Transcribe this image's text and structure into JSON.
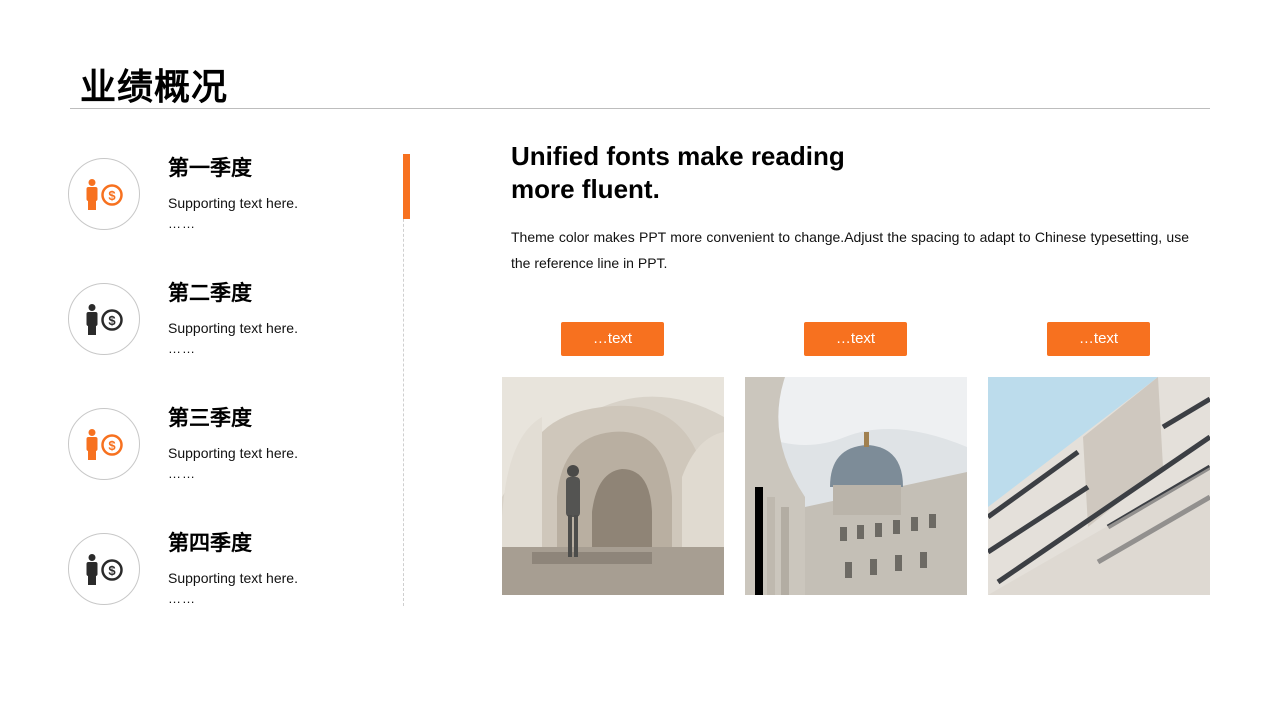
{
  "page": {
    "title": "业绩概况"
  },
  "quarters": [
    {
      "title": "第一季度",
      "text": "Supporting text here.",
      "more": "……",
      "icon_color": "#f7711f"
    },
    {
      "title": "第二季度",
      "text": "Supporting text here.",
      "more": "……",
      "icon_color": "#2b2b2b"
    },
    {
      "title": "第三季度",
      "text": "Supporting text here.",
      "more": "……",
      "icon_color": "#f7711f"
    },
    {
      "title": "第四季度",
      "text": "Supporting text here.",
      "more": "……",
      "icon_color": "#2b2b2b"
    }
  ],
  "content": {
    "heading": "Unified fonts make reading more fluent.",
    "body": "Theme color makes PPT more convenient to change.Adjust the spacing to adapt to Chinese typesetting, use the reference line in PPT."
  },
  "tags": [
    "…text",
    "…text",
    "…text"
  ],
  "images": [
    "stone-arches-statue-photo",
    "domed-building-photo",
    "modern-facade-photo"
  ],
  "colors": {
    "accent": "#f7711f",
    "dark": "#2b2b2b",
    "rule": "#bdbdbd"
  }
}
